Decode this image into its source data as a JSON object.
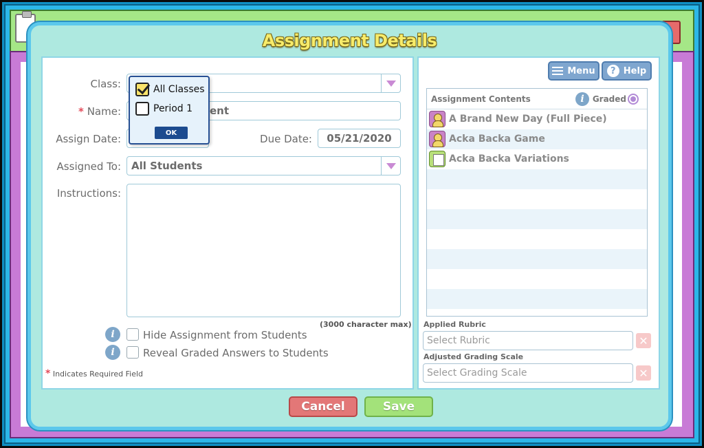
{
  "dialog": {
    "title": "Assignment Details"
  },
  "form": {
    "class_label": "Class:",
    "name_label": "Name:",
    "name_value_partial": "ent",
    "assign_date_label": "Assign Date:",
    "due_date_label": "Due Date:",
    "due_date_value": "05/21/2020",
    "assigned_to_label": "Assigned To:",
    "assigned_to_value": "All Students",
    "instructions_label": "Instructions:",
    "char_max": "(3000 character max)",
    "hide_label": "Hide Assignment from Students",
    "reveal_label": "Reveal Graded Answers to Students",
    "required_note": "Indicates Required Field",
    "required_star": "*"
  },
  "class_dropdown": {
    "options": [
      {
        "label": "All Classes",
        "checked": true
      },
      {
        "label": "Period 1",
        "checked": false
      }
    ],
    "ok_label": "OK"
  },
  "right_panel": {
    "menu_label": "Menu",
    "help_label": "Help",
    "contents_title": "Assignment Contents",
    "graded_label": "Graded",
    "items": [
      {
        "label": "A Brand New Day (Full Piece)",
        "icon": "person-icon"
      },
      {
        "label": "Acka Backa Game",
        "icon": "person-icon"
      },
      {
        "label": "Acka Backa Variations",
        "icon": "document-icon"
      }
    ],
    "rubric_label": "Applied Rubric",
    "rubric_placeholder": "Select Rubric",
    "scale_label": "Adjusted Grading Scale",
    "scale_placeholder": "Select Grading Scale",
    "clear_glyph": "✕"
  },
  "footer": {
    "cancel_label": "Cancel",
    "save_label": "Save"
  },
  "icons": {
    "info_glyph": "i",
    "help_glyph": "?"
  },
  "colors": {
    "title_yellow": "#f7ec6a",
    "cancel_red": "#e37777",
    "save_green": "#a3e27a",
    "accent_purple": "#c98ad4"
  }
}
